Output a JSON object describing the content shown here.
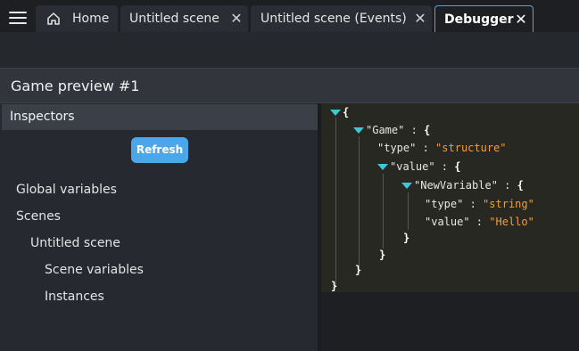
{
  "tabs": [
    {
      "label": "Home"
    },
    {
      "label": "Untitled scene"
    },
    {
      "label": "Untitled scene (Events)"
    },
    {
      "label": "Debugger"
    }
  ],
  "panel": {
    "title": "Game preview #1"
  },
  "inspectors": {
    "title": "Inspectors",
    "refresh_label": "Refresh",
    "tree": [
      "Global variables",
      "Scenes",
      "Untitled scene",
      "Scene variables",
      "Instances"
    ]
  },
  "json_view": {
    "open_brace": "{",
    "game_key": "\"Game\"",
    "type_key": "\"type\"",
    "type_value": "\"structure\"",
    "value_key": "\"value\"",
    "newvar_key": "\"NewVariable\"",
    "nv_type_key": "\"type\"",
    "nv_type_value": "\"string\"",
    "nv_value_key": "\"value\"",
    "nv_value_value": "\"Hello\""
  }
}
